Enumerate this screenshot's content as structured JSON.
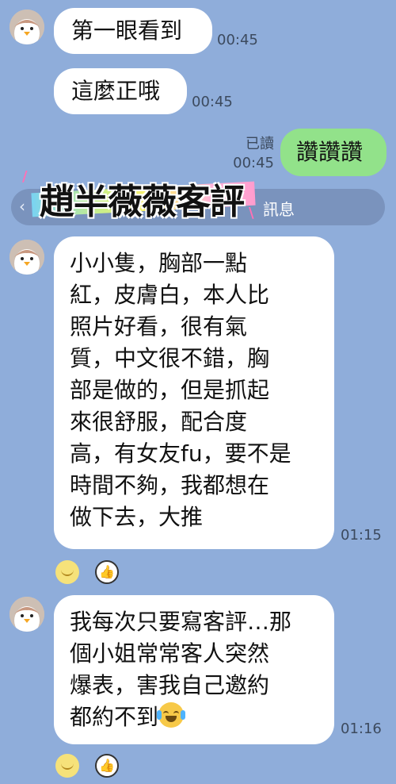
{
  "messages": [
    {
      "text": "第一眼看到",
      "time": "00:45"
    },
    {
      "text": "這麼正哦",
      "time": "00:45"
    },
    {
      "text": "讚讚讚",
      "time": "00:45",
      "read": "已讀"
    },
    {
      "lines": [
        "小小隻，胸部一點",
        "紅，皮膚白，本人比",
        "照片好看，很有氣",
        "質，中文很不錯，胸",
        "部是做的，但是抓起",
        "來很舒服，配合度",
        "高，有女友fu，要不是",
        "時間不夠，我都想在",
        "做下去，大推"
      ],
      "time": "01:15"
    },
    {
      "lines": [
        "我每次只要寫客評…那",
        "個小姐常常客人突然",
        "爆表，害我自己邀約",
        "都約不到"
      ],
      "time": "01:16"
    }
  ],
  "notice": {
    "text": "訊息",
    "chevron": "‹"
  },
  "banner": {
    "text": "趙半薇薇客評"
  },
  "icons": {
    "avatar": "penguin-avatar-icon",
    "crying_laughing": "face-with-tears-of-joy-icon",
    "react_smile": "smile-emoji-icon",
    "react_thumb": "thumbs-up-emoji-icon"
  },
  "colors": {
    "background": "#8fadda",
    "incoming_bubble": "#ffffff",
    "outgoing_bubble": "#92e28a"
  }
}
